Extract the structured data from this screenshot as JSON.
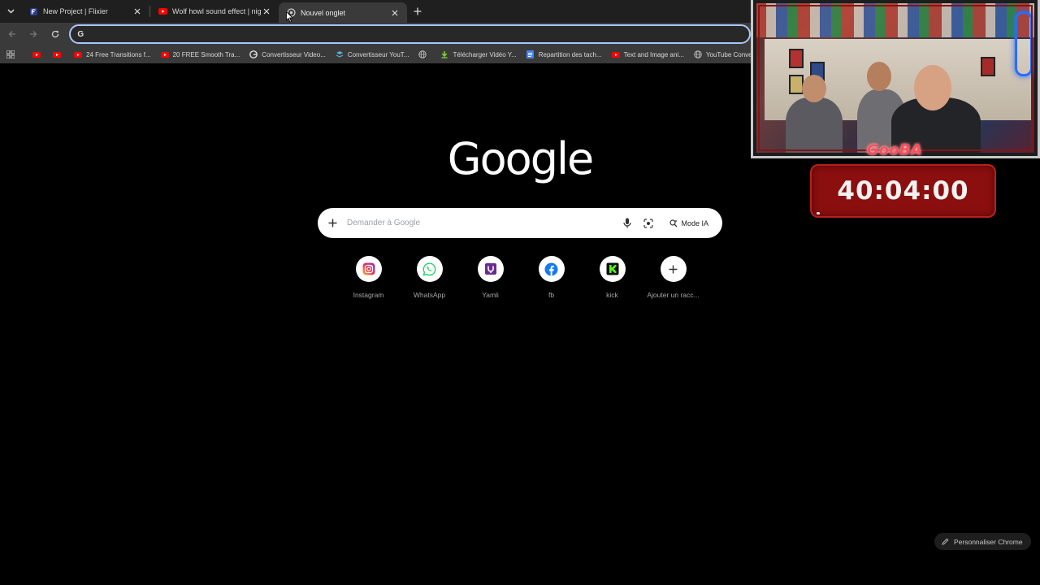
{
  "browser": {
    "tabs": [
      {
        "title": "New Project | Flixier",
        "icon": "flixier-icon"
      },
      {
        "title": "Wolf howl sound effect | night",
        "icon": "youtube-icon"
      },
      {
        "title": "Nouvel onglet",
        "icon": "chrome-newtab-icon",
        "active": true
      }
    ],
    "address_value": ""
  },
  "bookmarks": [
    {
      "label": "",
      "icon": "youtube-icon"
    },
    {
      "label": "",
      "icon": "youtube-icon"
    },
    {
      "label": "24 Free Transitions f...",
      "icon": "youtube-icon"
    },
    {
      "label": "20 FREE Smooth Tra...",
      "icon": "youtube-icon"
    },
    {
      "label": "Convertisseur Video...",
      "icon": "google-icon"
    },
    {
      "label": "Convertisseur YouT...",
      "icon": "converter-icon"
    },
    {
      "label": "",
      "icon": "globe-icon"
    },
    {
      "label": "Télécharger Vidéo Y...",
      "icon": "download-icon"
    },
    {
      "label": "Repartition des tach...",
      "icon": "docs-icon"
    },
    {
      "label": "Text and Image ani...",
      "icon": "youtube-icon"
    },
    {
      "label": "YouTube Converter...",
      "icon": "globe-icon"
    }
  ],
  "newtab": {
    "logo": "Google",
    "search_placeholder": "Demander à Google",
    "mode_label": "Mode IA",
    "shortcuts": [
      {
        "label": "Instagram",
        "icon": "instagram-icon"
      },
      {
        "label": "WhatsApp",
        "icon": "whatsapp-icon"
      },
      {
        "label": "Yamli",
        "icon": "yamli-icon"
      },
      {
        "label": "fb",
        "icon": "facebook-icon"
      },
      {
        "label": "kick",
        "icon": "kick-icon"
      },
      {
        "label": "Ajouter un racc...",
        "icon": "plus-icon"
      }
    ],
    "customize_label": "Personnaliser Chrome"
  },
  "overlay": {
    "cam_sign": "GooBA",
    "timer": "40:04:00",
    "timer_progress": 0.02
  },
  "colors": {
    "accent": "#a8c7fa",
    "timer_bg": "#8b0f0f",
    "youtube": "#ff0000"
  }
}
